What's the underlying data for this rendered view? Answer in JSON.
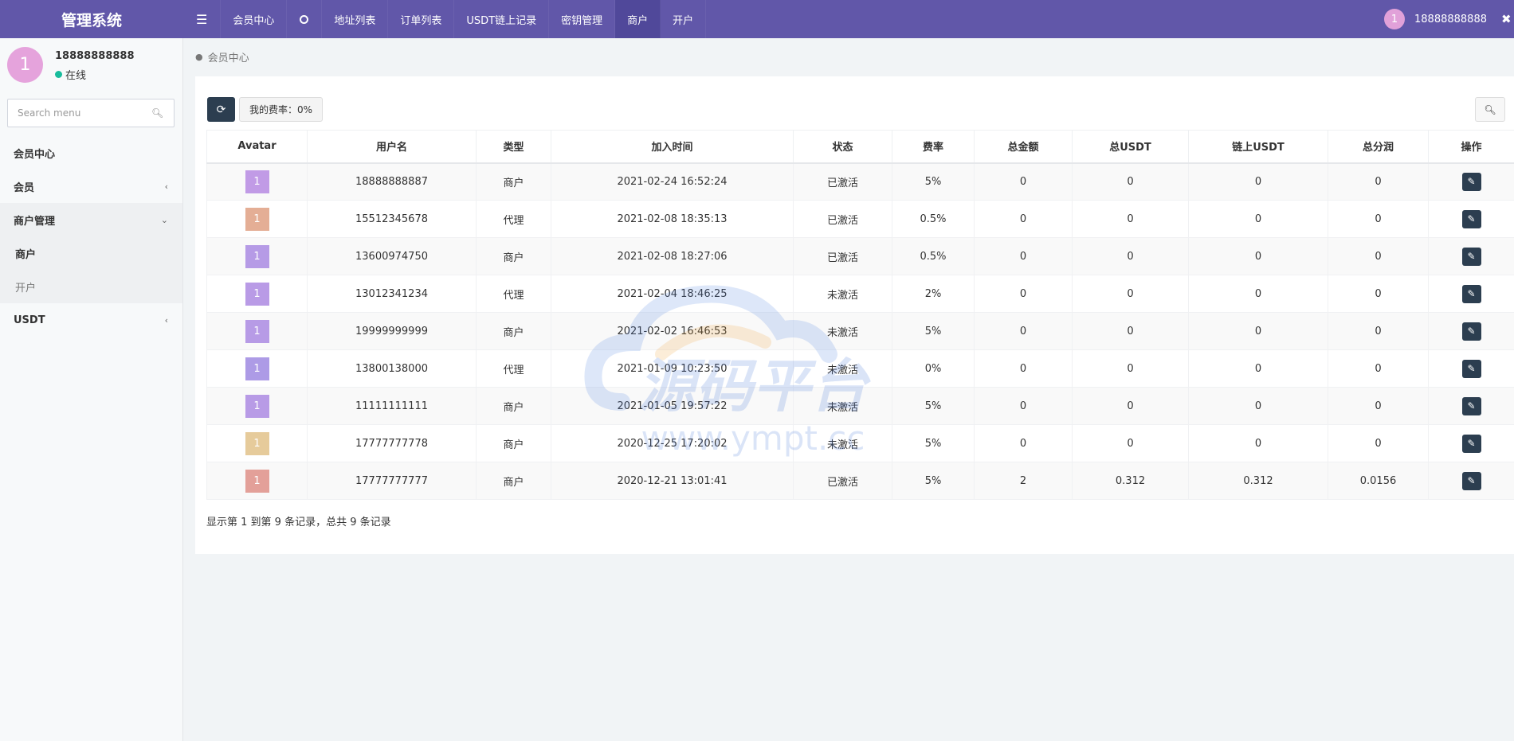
{
  "brand": "管理系统",
  "topnav": {
    "menu_icon": "☰",
    "items": [
      "会员中心",
      "地址列表",
      "订单列表",
      "USDT链上记录",
      "密钥管理",
      "商户",
      "开户"
    ]
  },
  "topright": {
    "avatar_text": "1",
    "username": "18888888888"
  },
  "sidebar": {
    "avatar_text": "1",
    "username": "18888888888",
    "status": "在线",
    "search_placeholder": "Search menu",
    "menu": {
      "member_center": "会员中心",
      "member": "会员",
      "merchant_mgmt": "商户管理",
      "merchant": "商户",
      "open_account": "开户",
      "usdt": "USDT"
    }
  },
  "breadcrumb": "会员中心",
  "toolbar": {
    "rate_label": "我的费率：0%"
  },
  "table": {
    "headers": [
      "Avatar",
      "用户名",
      "类型",
      "加入时间",
      "状态",
      "费率",
      "总金额",
      "总USDT",
      "链上USDT",
      "总分润",
      "操作"
    ],
    "rows": [
      {
        "avatar": "1",
        "color": "#c19be6",
        "username": "18888888887",
        "type": "商户",
        "joined": "2021-02-24 16:52:24",
        "status": "已激活",
        "rate": "5%",
        "total_amount": "0",
        "total_usdt": "0",
        "chain_usdt": "0",
        "profit": "0"
      },
      {
        "avatar": "1",
        "color": "#e4ae95",
        "username": "15512345678",
        "type": "代理",
        "joined": "2021-02-08 18:35:13",
        "status": "已激活",
        "rate": "0.5%",
        "total_amount": "0",
        "total_usdt": "0",
        "chain_usdt": "0",
        "profit": "0"
      },
      {
        "avatar": "1",
        "color": "#b69be6",
        "username": "13600974750",
        "type": "商户",
        "joined": "2021-02-08 18:27:06",
        "status": "已激活",
        "rate": "0.5%",
        "total_amount": "0",
        "total_usdt": "0",
        "chain_usdt": "0",
        "profit": "0"
      },
      {
        "avatar": "1",
        "color": "#b99be6",
        "username": "13012341234",
        "type": "代理",
        "joined": "2021-02-04 18:46:25",
        "status": "未激活",
        "rate": "2%",
        "total_amount": "0",
        "total_usdt": "0",
        "chain_usdt": "0",
        "profit": "0"
      },
      {
        "avatar": "1",
        "color": "#b79be6",
        "username": "19999999999",
        "type": "商户",
        "joined": "2021-02-02 16:46:53",
        "status": "未激活",
        "rate": "5%",
        "total_amount": "0",
        "total_usdt": "0",
        "chain_usdt": "0",
        "profit": "0"
      },
      {
        "avatar": "1",
        "color": "#ad9be6",
        "username": "13800138000",
        "type": "代理",
        "joined": "2021-01-09 10:23:50",
        "status": "未激活",
        "rate": "0%",
        "total_amount": "0",
        "total_usdt": "0",
        "chain_usdt": "0",
        "profit": "0"
      },
      {
        "avatar": "1",
        "color": "#b89be6",
        "username": "11111111111",
        "type": "商户",
        "joined": "2021-01-05 19:57:22",
        "status": "未激活",
        "rate": "5%",
        "total_amount": "0",
        "total_usdt": "0",
        "chain_usdt": "0",
        "profit": "0"
      },
      {
        "avatar": "1",
        "color": "#e6cb9b",
        "username": "17777777778",
        "type": "商户",
        "joined": "2020-12-25 17:20:02",
        "status": "未激活",
        "rate": "5%",
        "total_amount": "0",
        "total_usdt": "0",
        "chain_usdt": "0",
        "profit": "0"
      },
      {
        "avatar": "1",
        "color": "#e3a099",
        "username": "17777777777",
        "type": "商户",
        "joined": "2020-12-21 13:01:41",
        "status": "已激活",
        "rate": "5%",
        "total_amount": "2",
        "total_usdt": "0.312",
        "chain_usdt": "0.312",
        "profit": "0.0156"
      }
    ]
  },
  "pagination_info": "显示第 1 到第 9 条记录，总共 9 条记录",
  "watermark": {
    "title": "源码平台",
    "url": "www.ympt.cc"
  }
}
